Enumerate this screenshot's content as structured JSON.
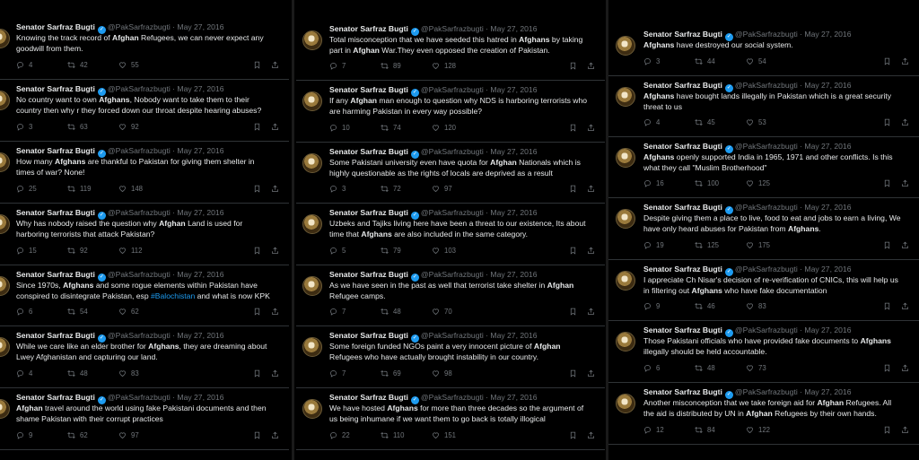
{
  "author": {
    "name": "Senator Sarfraz Bugti",
    "handle": "@PakSarfrazbugti",
    "date": "May 27, 2016",
    "separator": "·"
  },
  "columns": [
    {
      "tweets": [
        {
          "text": [
            [
              "Knowing the track record of ",
              ""
            ],
            [
              "Afghan",
              "b"
            ],
            [
              " Refugees, we can never expect any",
              ""
            ],
            [
              "\n",
              ""
            ],
            [
              "goodwill from them.",
              ""
            ]
          ],
          "replies": "4",
          "retweets": "42",
          "likes": "55"
        },
        {
          "text": [
            [
              "No country want to own ",
              ""
            ],
            [
              "Afghans",
              "b"
            ],
            [
              ", Nobody want to take them to their",
              ""
            ],
            [
              "\n",
              ""
            ],
            [
              "country then why r they forced down our throat despite hearing abuses?",
              ""
            ]
          ],
          "replies": "3",
          "retweets": "63",
          "likes": "92"
        },
        {
          "text": [
            [
              "How many ",
              ""
            ],
            [
              "Afghans",
              "b"
            ],
            [
              " are thankful to Pakistan for giving them shelter in",
              ""
            ],
            [
              "\n",
              ""
            ],
            [
              "times of war? None!",
              ""
            ]
          ],
          "replies": "25",
          "retweets": "119",
          "likes": "148"
        },
        {
          "text": [
            [
              "Why has nobody raised the question why ",
              ""
            ],
            [
              "Afghan",
              "b"
            ],
            [
              " Land is used for",
              ""
            ],
            [
              "\n",
              ""
            ],
            [
              "harboring terrorists that attack Pakistan?",
              ""
            ]
          ],
          "replies": "15",
          "retweets": "92",
          "likes": "112"
        },
        {
          "text": [
            [
              "Since 1970s, ",
              ""
            ],
            [
              "Afghans",
              "b"
            ],
            [
              " and some rogue elements within Pakistan have",
              ""
            ],
            [
              "\n",
              ""
            ],
            [
              "conspired to disintegrate Pakistan, esp ",
              ""
            ],
            [
              "#Balochistan",
              "t"
            ],
            [
              " and what is now KPK",
              ""
            ]
          ],
          "replies": "6",
          "retweets": "54",
          "likes": "62"
        },
        {
          "text": [
            [
              "While we care like an elder brother for ",
              ""
            ],
            [
              "Afghans",
              "b"
            ],
            [
              ", they are dreaming about",
              ""
            ],
            [
              "\n",
              ""
            ],
            [
              "Lwey Afghanistan and capturing our land.",
              ""
            ]
          ],
          "replies": "4",
          "retweets": "48",
          "likes": "83"
        },
        {
          "text": [
            [
              "Afghan",
              "b"
            ],
            [
              " travel around the world using fake Pakistani documents and then",
              ""
            ],
            [
              "\n",
              ""
            ],
            [
              "shame Pakistan with their corrupt practices",
              ""
            ]
          ],
          "replies": "9",
          "retweets": "62",
          "likes": "97"
        }
      ]
    },
    {
      "tweets": [
        {
          "text": [
            [
              "Total misconception that we have seeded this hatred in ",
              ""
            ],
            [
              "Afghans",
              "b"
            ],
            [
              " by taking",
              ""
            ],
            [
              "\n",
              ""
            ],
            [
              "part in ",
              ""
            ],
            [
              "Afghan",
              "b"
            ],
            [
              " War.They even opposed the creation of Pakistan.",
              ""
            ]
          ],
          "replies": "7",
          "retweets": "89",
          "likes": "128"
        },
        {
          "text": [
            [
              "If any ",
              ""
            ],
            [
              "Afghan",
              "b"
            ],
            [
              " man enough to question why NDS is harboring terrorists who",
              ""
            ],
            [
              "\n",
              ""
            ],
            [
              "are harming Pakistan in every way possible?",
              ""
            ]
          ],
          "replies": "10",
          "retweets": "74",
          "likes": "120"
        },
        {
          "text": [
            [
              "Some Pakistani university even have quota for ",
              ""
            ],
            [
              "Afghan",
              "b"
            ],
            [
              " Nationals which is",
              ""
            ],
            [
              "\n",
              ""
            ],
            [
              "highly questionable as the rights of locals are deprived as a result",
              ""
            ]
          ],
          "replies": "3",
          "retweets": "72",
          "likes": "97"
        },
        {
          "text": [
            [
              "Uzbeks and Tajiks living here have been a threat to our existence, Its about",
              ""
            ],
            [
              "\n",
              ""
            ],
            [
              "time that ",
              ""
            ],
            [
              "Afghans",
              "b"
            ],
            [
              " are also included in the same category.",
              ""
            ]
          ],
          "replies": "5",
          "retweets": "79",
          "likes": "103"
        },
        {
          "text": [
            [
              "As we have seen in the past as well that terrorist take shelter in ",
              ""
            ],
            [
              "Afghan",
              "b"
            ],
            [
              "\n",
              ""
            ],
            [
              "Refugee camps.",
              ""
            ]
          ],
          "replies": "7",
          "retweets": "48",
          "likes": "70"
        },
        {
          "text": [
            [
              "Some foreign funded NGOs paint a very innocent picture of ",
              ""
            ],
            [
              "Afghan",
              "b"
            ],
            [
              "\n",
              ""
            ],
            [
              "Refugees who have actually brought instability in our country.",
              ""
            ]
          ],
          "replies": "7",
          "retweets": "69",
          "likes": "98"
        },
        {
          "text": [
            [
              "We have hosted ",
              ""
            ],
            [
              "Afghans",
              "b"
            ],
            [
              " for more than three decades so the argument of",
              ""
            ],
            [
              "\n",
              ""
            ],
            [
              "us being inhumane if we want them to go back is totally illogical",
              ""
            ]
          ],
          "replies": "22",
          "retweets": "110",
          "likes": "151"
        }
      ]
    },
    {
      "tweets": [
        {
          "text": [
            [
              "Afghans",
              "b"
            ],
            [
              " have destroyed our social system.",
              ""
            ]
          ],
          "replies": "3",
          "retweets": "44",
          "likes": "54"
        },
        {
          "text": [
            [
              "Afghans",
              "b"
            ],
            [
              " have bought lands illegally in Pakistan which is a great security",
              ""
            ],
            [
              "\n",
              ""
            ],
            [
              "threat to us",
              ""
            ]
          ],
          "replies": "4",
          "retweets": "45",
          "likes": "53"
        },
        {
          "text": [
            [
              "Afghans",
              "b"
            ],
            [
              " openly supported India in 1965, 1971 and other conflicts. Is this",
              ""
            ],
            [
              "\n",
              ""
            ],
            [
              "what they call \"Muslim Brotherhood\"",
              ""
            ]
          ],
          "replies": "16",
          "retweets": "100",
          "likes": "125"
        },
        {
          "text": [
            [
              "Despite giving them a place to live, food to eat and jobs to earn a living, We",
              ""
            ],
            [
              "\n",
              ""
            ],
            [
              "have only heard abuses for Pakistan from ",
              ""
            ],
            [
              "Afghans",
              "b"
            ],
            [
              ".",
              ""
            ]
          ],
          "replies": "19",
          "retweets": "125",
          "likes": "175"
        },
        {
          "text": [
            [
              "I appreciate Ch Nisar's decision of re-verification of CNICs, this will help us",
              ""
            ],
            [
              "\n",
              ""
            ],
            [
              "in filtering out ",
              ""
            ],
            [
              "Afghans",
              "b"
            ],
            [
              " who have fake documentation",
              ""
            ]
          ],
          "replies": "9",
          "retweets": "46",
          "likes": "83"
        },
        {
          "text": [
            [
              "Those Pakistani officials who have provided fake documents to ",
              ""
            ],
            [
              "Afghans",
              "b"
            ],
            [
              "\n",
              ""
            ],
            [
              "illegally should be held accountable.",
              ""
            ]
          ],
          "replies": "6",
          "retweets": "48",
          "likes": "73"
        },
        {
          "text": [
            [
              "Another misconception that we take foreign aid for ",
              ""
            ],
            [
              "Afghan",
              "b"
            ],
            [
              " Refugees. All",
              ""
            ],
            [
              "\n",
              ""
            ],
            [
              "the aid is distributed by UN in ",
              ""
            ],
            [
              "Afghan",
              "b"
            ],
            [
              " Refugees by their own hands.",
              ""
            ]
          ],
          "replies": "12",
          "retweets": "84",
          "likes": "122"
        }
      ]
    }
  ]
}
